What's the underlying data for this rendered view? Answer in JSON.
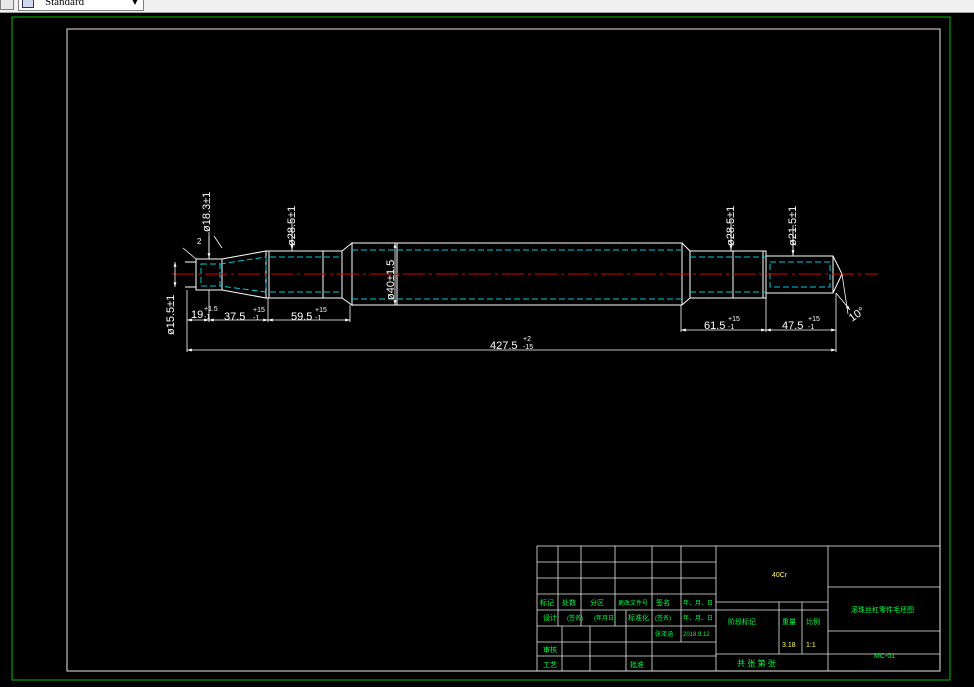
{
  "toolbar": {
    "style_combo_value": "Standard"
  },
  "dimensions": {
    "d_left_end": "ø15.5±1",
    "d_left_taper": "ø18.3±1",
    "d_left_journal": "ø28.5±1",
    "d_middle": "ø40±1.5",
    "d_right_journal": "ø28.5±1",
    "d_right_end": "ø21.5±1",
    "l_19": "19",
    "l_19_tol_upper": "+1.5",
    "l_19_tol_lower": "-1",
    "l_37_5": "37.5",
    "l_37_5_tol_upper": "+15",
    "l_37_5_tol_lower": "-1",
    "l_59_5": "59.5",
    "l_59_5_tol_upper": "+15",
    "l_59_5_tol_lower": "-1",
    "l_61_5": "61.5",
    "l_61_5_tol_upper": "+15",
    "l_61_5_tol_lower": "-1",
    "l_47_5": "47.5",
    "l_47_5_tol_upper": "+15",
    "l_47_5_tol_lower": "-1",
    "overall": "427.5",
    "overall_tol_upper": "+2",
    "overall_tol_lower": "-15",
    "angle": "10°",
    "chamfer_small": "2"
  },
  "title_block": {
    "material": "40Cr",
    "drawing_title": "滚珠丝杠零件毛坯图",
    "drawing_number": "MC-01",
    "mark": "标记",
    "count": "处数",
    "zone": "分区",
    "change_doc": "更改文件号",
    "signature": "签名",
    "date": "年、月、日",
    "design": "设计",
    "design_sign": "(签名)",
    "design_date": "(年月日)",
    "standardize": "标准化",
    "std_sign": "(签名)",
    "std_date": "年、月、日",
    "stage_mark": "阶段标记",
    "weight": "重量",
    "scale": "比例",
    "signer": "张泽涵",
    "sign_date": "2018.9.12",
    "weight_value": "3.18",
    "scale_value": "1:1",
    "review": "审核",
    "process": "工艺",
    "approve": "批准",
    "sheets": "共  张  第  张"
  }
}
